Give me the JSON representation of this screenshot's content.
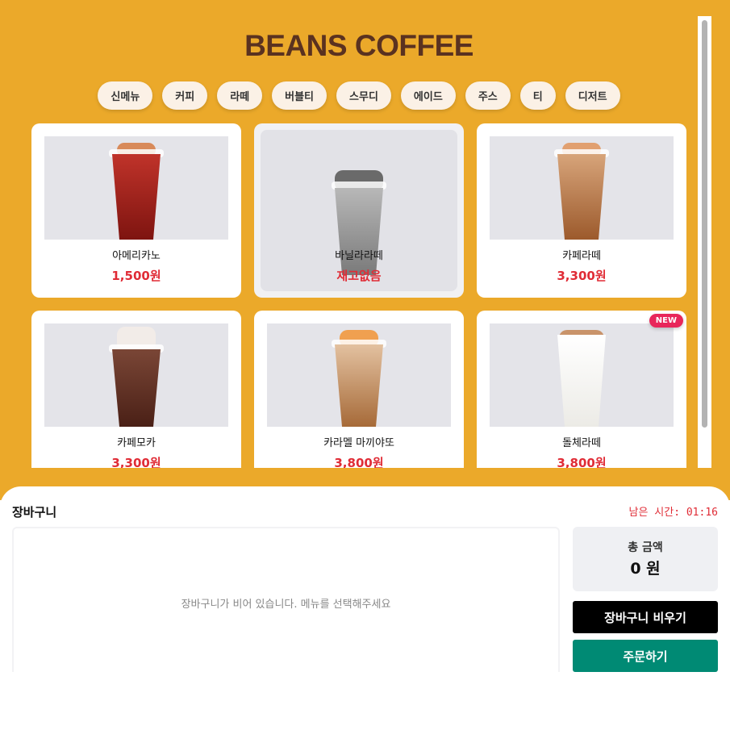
{
  "header": {
    "title": "BEANS COFFEE"
  },
  "categories": [
    "신메뉴",
    "커피",
    "라떼",
    "버블티",
    "스무디",
    "에이드",
    "주스",
    "티",
    "디저트"
  ],
  "products": [
    {
      "name": "아메리카노",
      "price": "1,500원",
      "cup_color": "#8e1c12"
    },
    {
      "name": "바닐라라떼",
      "price": "재고없음",
      "cup_color": "#8c8c8c",
      "sold_out": true
    },
    {
      "name": "카페라떼",
      "price": "3,300원",
      "cup_color": "#a86a3c"
    },
    {
      "name": "카페모카",
      "price": "3,300원",
      "cup_color": "#5a2c1e"
    },
    {
      "name": "카라멜 마끼야또",
      "price": "3,800원",
      "cup_color": "#b0774a"
    },
    {
      "name": "돌체라떼",
      "price": "3,800원",
      "cup_color": "#ffffff",
      "badge": "NEW"
    }
  ],
  "cart": {
    "title": "장바구니",
    "timer": "남은 시간: 01:16",
    "empty_message": "장바구니가 비어 있습니다. 메뉴를 선택해주세요",
    "total_label": "총 금액",
    "total_value": "0 원",
    "clear_button": "장바구니 비우기",
    "order_button": "주문하기"
  },
  "colors": {
    "background": "#eba92a",
    "title": "#5a3220",
    "price": "#e02c36",
    "order": "#008a74",
    "new_badge": "#e8265a"
  }
}
